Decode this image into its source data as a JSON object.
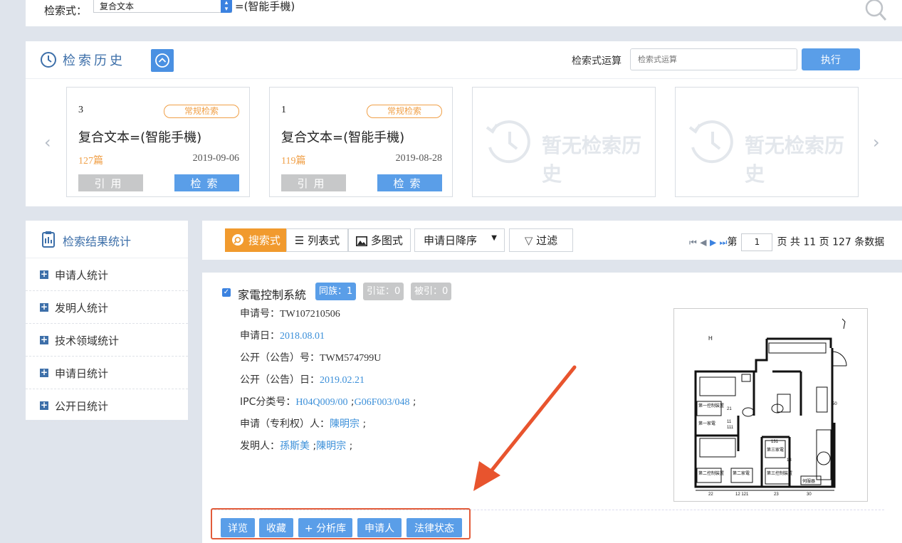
{
  "query_bar": {
    "label": "检索式：",
    "field_selected": "复合文本",
    "query_text": "=(智能手機)"
  },
  "history": {
    "title": "检索历史",
    "op_label": "检索式运算",
    "op_placeholder": "检索式运算",
    "run_label": "执行",
    "cards": [
      {
        "num": "3",
        "badge": "常规检索",
        "query": "复合文本=(智能手機)",
        "count": "127篇",
        "date": "2019-09-06",
        "cite": "引用",
        "search": "检索"
      },
      {
        "num": "1",
        "badge": "常规检索",
        "query": "复合文本=(智能手機)",
        "count": "119篇",
        "date": "2019-08-28",
        "cite": "引用",
        "search": "检索"
      }
    ],
    "empty_text": "暂无检索历史"
  },
  "stats": {
    "title": "检索结果统计",
    "items": [
      "申请人统计",
      "发明人统计",
      "技术领域统计",
      "申请日统计",
      "公开日统计"
    ]
  },
  "toolbar": {
    "view_search": "搜索式",
    "view_list": "列表式",
    "view_multi": "多图式",
    "sort": "申请日降序",
    "filter": "过滤",
    "page_prefix": "第",
    "page_value": "1",
    "page_suffix": "页 共 11 页 127 条数据"
  },
  "result": {
    "title": "家電控制系統",
    "tag_family": "同族：1",
    "tag_cite": "引证：0",
    "tag_cited": "被引：0",
    "app_no_label": "申请号：",
    "app_no": "TW107210506",
    "app_date_label": "申请日：",
    "app_date": "2018.08.01",
    "pub_no_label": "公开（公告）号：",
    "pub_no": "TWM574799U",
    "pub_date_label": "公开（公告）日：",
    "pub_date": "2019.02.21",
    "ipc_label": "IPC分类号：",
    "ipc_1": "H04Q009/00",
    "ipc_2": "G06F003/048",
    "applicant_label": "申请（专利权）人：",
    "applicant": "陳明宗",
    "inventor_label": "发明人：",
    "inventor_1": "孫斯美",
    "inventor_2": "陳明宗",
    "actions": [
      "详览",
      "收藏",
      "+ 分析库",
      "申请人",
      "法律状态"
    ]
  },
  "drawing_labels": {
    "top_letter": "H",
    "r1": "第一控制裝置",
    "r2": "第一家電",
    "r3": "第二控制裝置",
    "r4": "第二家電",
    "r5": "第三家電",
    "r6": "第三控制裝置",
    "r7": "伺服器",
    "n21": "21",
    "n11": "11",
    "n111": "111",
    "n50": "50",
    "n131": "131",
    "n13": "13",
    "b22": "22",
    "b12": "12 121",
    "b23": "23",
    "b30": "30"
  }
}
